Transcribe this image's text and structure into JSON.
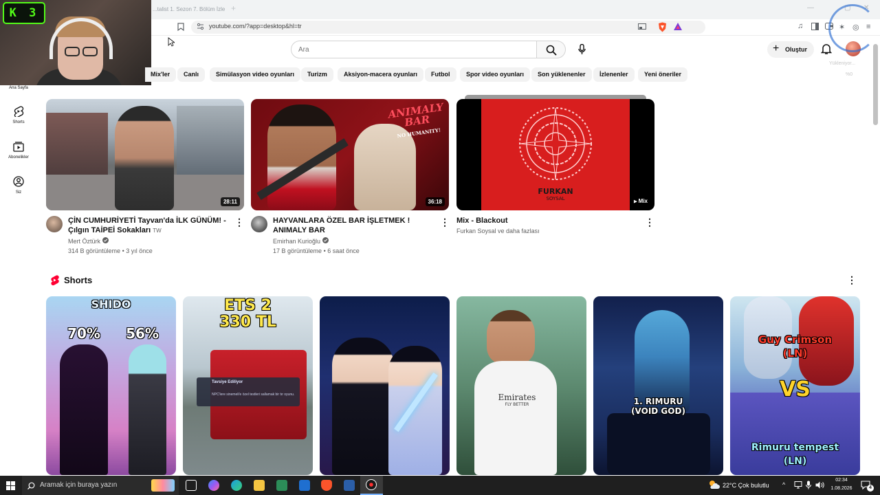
{
  "browser": {
    "tab_title": "...talist 1. Sezon 7. Bölüm İzle",
    "new_tab": "+",
    "url": "youtube.com/?app=desktop&hl=tr",
    "controls": {
      "minimize": "—",
      "maximize": "▢",
      "close": "✕"
    }
  },
  "webcam": {
    "overlay_label": "K 3"
  },
  "youtube": {
    "search_placeholder": "Ara",
    "create_label": "Oluştur",
    "ghost_text": {
      "line1": "Yükleniyor...",
      "line2": "%0"
    },
    "chips": [
      "Mix'ler",
      "Canlı",
      "Simülasyon video oyunları",
      "Turizm",
      "Aksiyon-macera oyunları",
      "Futbol",
      "Spor video oyunları",
      "Son yüklenenler",
      "İzlenenler",
      "Yeni öneriler"
    ],
    "sidebar": [
      {
        "label": "Ana Sayfa",
        "icon": "home-icon"
      },
      {
        "label": "Shorts",
        "icon": "shorts-icon"
      },
      {
        "label": "Abonelikler",
        "icon": "subscriptions-icon"
      },
      {
        "label": "Siz",
        "icon": "you-icon"
      }
    ],
    "videos": [
      {
        "title": "ÇİN CUMHURİYETİ Tayvan'da İLK GÜNÜM! - Çılgın TAİPEİ Sokakları",
        "title_suffix": "TW",
        "channel": "Mert Öztürk",
        "verified": true,
        "views": "314 B görüntüleme",
        "age": "3 yıl önce",
        "duration": "28:11"
      },
      {
        "title": "HAYVANLARA ÖZEL BAR İŞLETMEK ! ANIMALY BAR",
        "channel": "Emirhan Kurioğlu",
        "verified": true,
        "views": "17 B görüntüleme",
        "age": "6 saat önce",
        "duration": "36:18",
        "thumb_text": {
          "line1": "ANIMALY",
          "line2": "BAR",
          "line3": "NO HUMANITY!"
        }
      },
      {
        "title": "Mix - Blackout",
        "channel": "Furkan Soysal ve daha fazlası",
        "badge": "Mix",
        "thumb_text": {
          "line1": "FURKAN",
          "line2": "SOYSAL"
        }
      }
    ],
    "meta_separator": "•",
    "shorts_title": "Shorts",
    "shorts": [
      {
        "top_text": "SHIDO",
        "left_text": "70%",
        "right_text": "56%"
      },
      {
        "line1": "ETS 2",
        "line2": "330 TL",
        "popup_title": "Tavsiye Ediliyor",
        "popup_body": "NPC'lere sinemeli'e özel testleri sallamak bir tır oyunu."
      },
      {},
      {
        "shirt_text": "Emirates",
        "shirt_sub": "FLY BETTER"
      },
      {
        "line1": "1. RIMURU",
        "line2": "(VOID GOD)"
      },
      {
        "line1": "Guy Crimson",
        "line2": "(LN)",
        "vs": "VS",
        "line3": "Rimuru tempest",
        "line4": "(LN)"
      }
    ]
  },
  "taskbar": {
    "search_placeholder": "Aramak için buraya yazın",
    "weather": "22°C  Çok bulutlu",
    "time": "02:34",
    "date": "1.08.2026",
    "notifications": "4"
  }
}
